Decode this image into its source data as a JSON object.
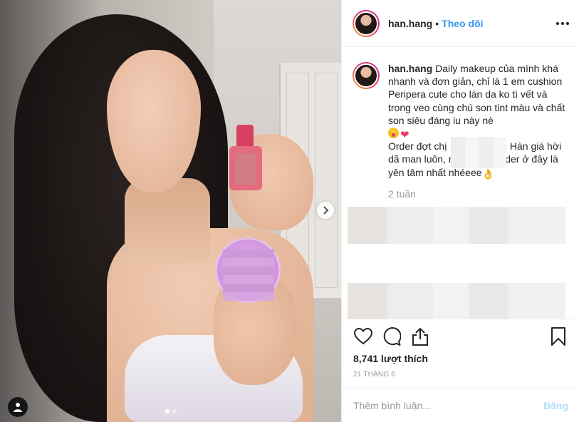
{
  "post": {
    "username": "han.hang",
    "separator": "•",
    "follow_label": "Theo dõi",
    "more_icon": "more-options-icon"
  },
  "caption": {
    "username": "han.hang",
    "text_1": "Daily makeup của mình khá nhanh và đơn giản, chỉ là 1 em cushion Peripera cute cho làn da ko tì vết và trong veo cùng chú son tint màu và chất son siêu đáng iu này nè",
    "text_2a": "Order đợt chị",
    "text_2b": "đi Hàn giá hời dã man luôn, mn follow/ order ở đây là yên tâm nhất nhéeee",
    "time_relative": "2 tuần"
  },
  "actions": {
    "like_icon": "heart-icon",
    "comment_icon": "comment-icon",
    "share_icon": "share-icon",
    "save_icon": "bookmark-icon",
    "likes": "8,741 lượt thích",
    "date": "21 THÁNG 6"
  },
  "comment_box": {
    "placeholder": "Thêm bình luận...",
    "post_label": "Đăng"
  },
  "carousel": {
    "slide_count": 2,
    "active_index": 0
  },
  "colors": {
    "link_blue": "#3897f0",
    "post_disabled": "#b2dffc",
    "muted": "#999999"
  }
}
